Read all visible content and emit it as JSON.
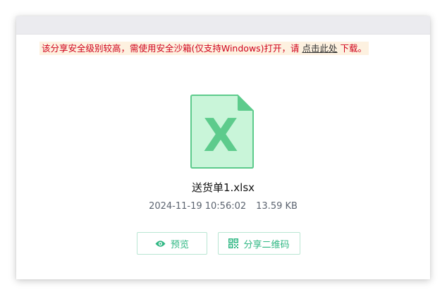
{
  "warning": {
    "text_before": "该分享安全级别较高，需使用安全沙箱(仅支持Windows)打开，请 ",
    "link_label": "点击此处",
    "text_after": " 下载。"
  },
  "file": {
    "icon": "excel-file-icon",
    "name": "送货单1.xlsx",
    "date": "2024-11-19 10:56:02",
    "size": "13.59 KB"
  },
  "actions": {
    "preview_label": "预览",
    "preview_icon": "eye-icon",
    "share_label": "分享二维码",
    "share_icon": "qrcode-icon"
  },
  "colors": {
    "warning_text": "#d0021b",
    "warning_bg": "#fdf1e0",
    "accent": "#2fb783",
    "file_icon_fill": "#c9f5d9",
    "file_icon_stroke": "#5dcb8c"
  }
}
